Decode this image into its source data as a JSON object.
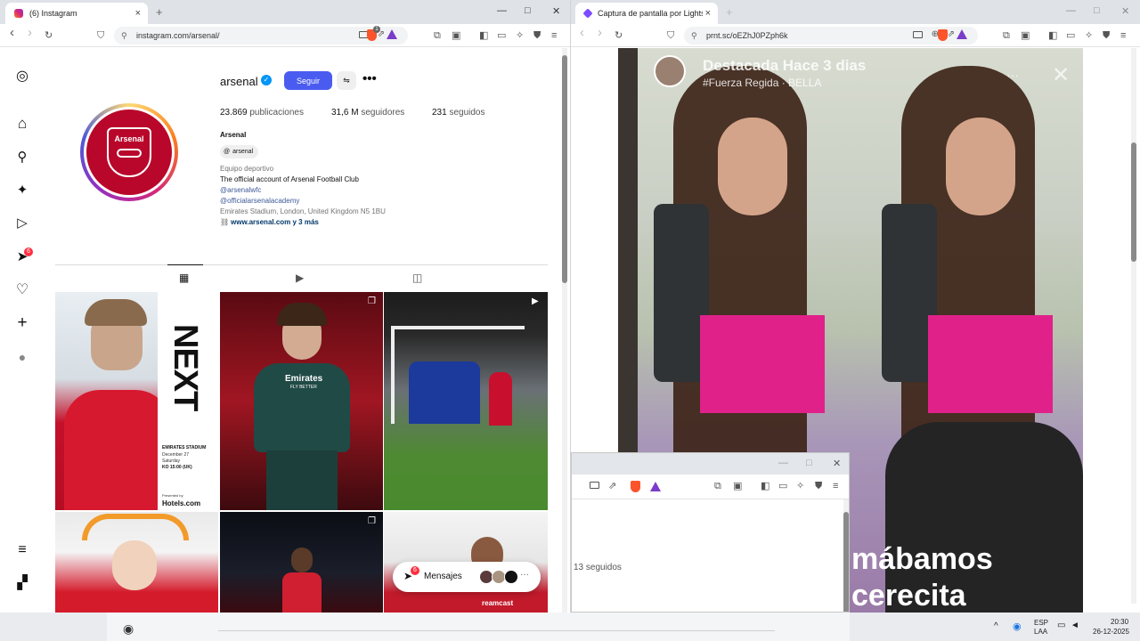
{
  "colors": {
    "brand_blue": "#4a5cf0",
    "arsenal_red": "#b8072a",
    "notif_red": "#ff3040",
    "brave_orange": "#fb542b"
  },
  "left_browser": {
    "tab_title": "(6) Instagram",
    "new_tab_icon": "+",
    "tab_close": "×",
    "window_controls": {
      "minimize": "—",
      "maximize": "□",
      "close": "✕"
    },
    "url": "instagram.com/arsenal/",
    "nav": {
      "back": "‹",
      "forward": "›",
      "reload": "↻",
      "bookmark": "⛉",
      "site_info": "⚲"
    },
    "toolbar_icons": [
      "cast-icon",
      "share-icon",
      "extensions-icon",
      "wallet-icon",
      "sidebar-icon",
      "menu-icon"
    ],
    "brave_count": "1"
  },
  "instagram": {
    "sidebar": {
      "logo_icon": "◎",
      "items": [
        {
          "name": "home",
          "glyph": "⌂"
        },
        {
          "name": "search",
          "glyph": "⚲"
        },
        {
          "name": "explore",
          "glyph": "✦"
        },
        {
          "name": "reels",
          "glyph": "▷"
        },
        {
          "name": "messages",
          "glyph": "➤"
        },
        {
          "name": "notifications",
          "glyph": "♡"
        },
        {
          "name": "create",
          "glyph": "+"
        },
        {
          "name": "profile",
          "glyph": "●"
        }
      ],
      "messages_badge": "6",
      "more_icon": "≡",
      "meta_icon": "▞"
    },
    "profile": {
      "avatar_text": "Arsenal",
      "username": "arsenal",
      "verified_glyph": "✓",
      "follow_label": "Seguir",
      "suggest_glyph": "⇋",
      "more_glyph": "•••",
      "stats": [
        {
          "value": "23.869",
          "label": "publicaciones"
        },
        {
          "value": "31,6 M",
          "label": "seguidores"
        },
        {
          "value": "231",
          "label": "seguidos"
        }
      ],
      "display_name": "Arsenal",
      "threads_handle": "arsenal",
      "threads_glyph": "@",
      "category": "Equipo deportivo",
      "bio_line": "The official account of Arsenal Football Club",
      "mention_1": "@arsenalwfc",
      "mention_2": "@officialarsenalacademy",
      "location": "Emirates Stadium, London, United Kingdom N5 1BU",
      "link_glyph": "⛓",
      "link": "www.arsenal.com y 3 más"
    },
    "tabs": [
      {
        "name": "posts",
        "glyph": "▦"
      },
      {
        "name": "reels",
        "glyph": "▶"
      },
      {
        "name": "tagged",
        "glyph": "◫"
      }
    ],
    "grid": {
      "post1": {
        "big_text": "NEXT",
        "venue": "EMIRATES STADIUM",
        "date": "December 27",
        "day": "Saturday",
        "kickoff": "KO 15:00 (UK)",
        "sponsor_label": "Presented by",
        "sponsor": "Hotels.com"
      },
      "post2": {
        "sponsor": "Emirates",
        "tagline": "FLY BETTER"
      },
      "post6": {
        "sponsor": "reamcast"
      },
      "multi_glyph": "❐",
      "reel_glyph": "▶"
    },
    "messages_pill": {
      "label": "Mensajes",
      "badge": "6",
      "more": "···"
    }
  },
  "right_browser": {
    "tab_title": "Captura de pantalla por Lightsh",
    "tab_close": "×",
    "url": "prnt.sc/oEZhJ0PZph6k",
    "window_controls": {
      "minimize": "—",
      "maximize": "□",
      "close": "✕"
    },
    "story_header": "Destacada  Hace 3 dias",
    "story_sub": "#Fuerza Regida · BELLA",
    "story_close": "✕",
    "story_dots": "···",
    "caption_1": "mábamos",
    "caption_2": "cerecita"
  },
  "popup_window": {
    "window_controls": {
      "minimize": "—",
      "maximize": "□",
      "close": "✕"
    },
    "following_text": "13 seguidos"
  },
  "taskbar": {
    "lang": "ESP",
    "region": "LAA",
    "time": "20:30",
    "date": "26-12-2025",
    "chevron": "^",
    "mic_glyph": "◉"
  }
}
